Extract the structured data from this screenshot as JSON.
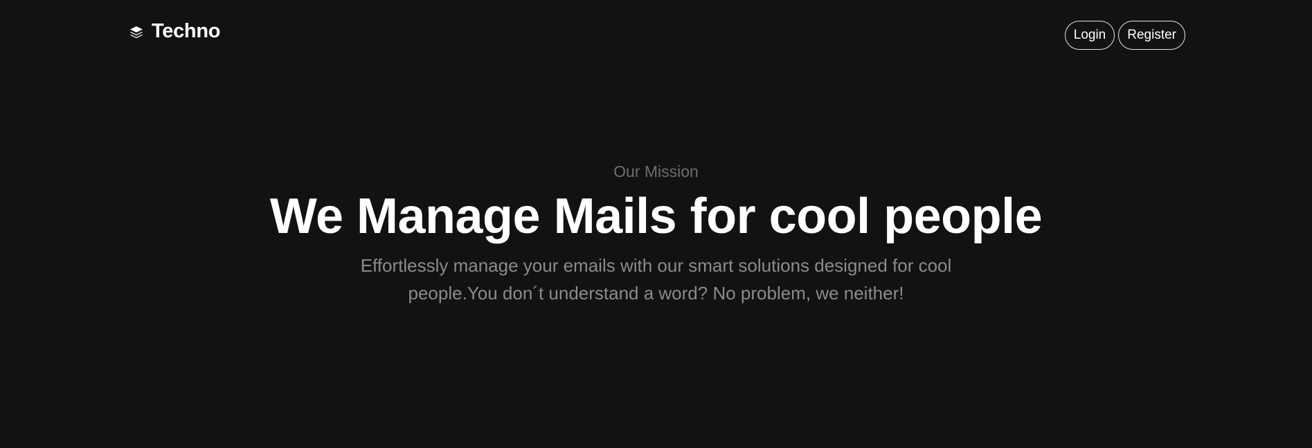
{
  "nav": {
    "brand": "Techno",
    "brand_icon": "layers-icon",
    "login_label": "Login",
    "register_label": "Register"
  },
  "hero": {
    "eyebrow": "Our Mission",
    "headline": "We Manage Mails for cool people",
    "description": "Effortlessly manage your emails with our smart solutions designed for cool people.You don´t understand a word? No problem, we neither!"
  },
  "colors": {
    "background": "#121212",
    "text_primary": "#ffffff",
    "text_muted": "#8b8b8b",
    "eyebrow": "#6f6f6f",
    "button_border": "#e6e6e6"
  }
}
